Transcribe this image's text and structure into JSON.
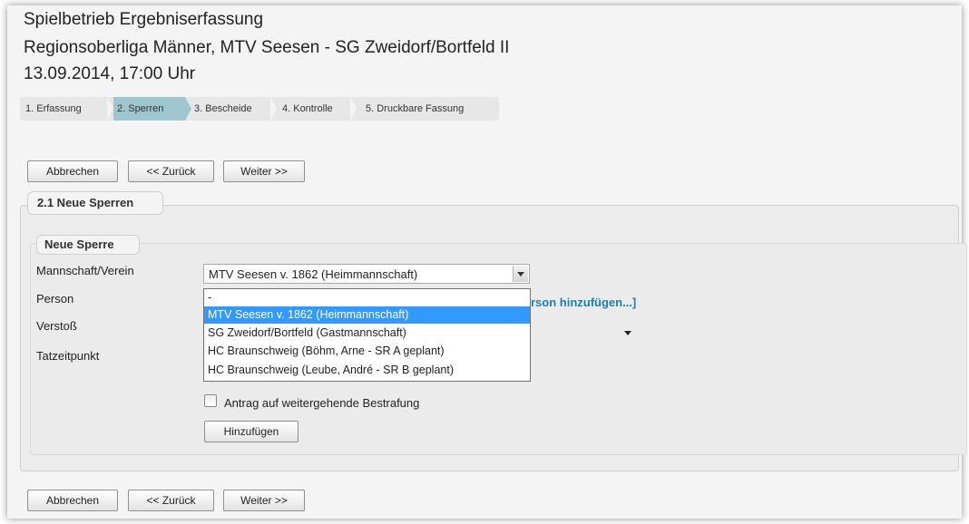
{
  "header": {
    "title": "Spielbetrieb Ergebniserfassung",
    "match": "Regionsoberliga Männer, MTV Seesen - SG Zweidorf/Bortfeld II",
    "datetime": "13.09.2014, 17:00 Uhr"
  },
  "steps": [
    {
      "label": "1. Erfassung",
      "active": false
    },
    {
      "label": "2. Sperren",
      "active": true
    },
    {
      "label": "3. Bescheide",
      "active": false
    },
    {
      "label": "4. Kontrolle",
      "active": false
    },
    {
      "label": "5. Druckbare Fassung",
      "active": false
    }
  ],
  "nav": {
    "cancel": "Abbrechen",
    "back": "<< Zurück",
    "next": "Weiter >>"
  },
  "section": {
    "title": "2.1 Neue Sperren",
    "subsection_title": "Neue Sperre"
  },
  "form": {
    "labels": {
      "mannschaft": "Mannschaft/Verein",
      "person": "Person",
      "verstoss": "Verstoß",
      "tatzeitpunkt": "Tatzeitpunkt"
    },
    "mannschaft_value": "MTV Seesen v. 1862 (Heimmannschaft)",
    "mannschaft_options": [
      "-",
      "MTV Seesen v. 1862 (Heimmannschaft)",
      "SG Zweidorf/Bortfeld (Gastmannschaft)",
      "HC Braunschweig (Böhm, Arne - SR A geplant)",
      "HC Braunschweig (Leube, André - SR B geplant)"
    ],
    "mannschaft_selected_index": 1,
    "add_person_link": "rson hinzufügen...]",
    "checkbox_label": "Antrag auf weitergehende Bestrafung",
    "checkbox_checked": false,
    "add_button": "Hinzufügen"
  },
  "colors": {
    "active_step": "#9fc6cf",
    "selection": "#3399ff",
    "link": "#1a7fb5"
  }
}
